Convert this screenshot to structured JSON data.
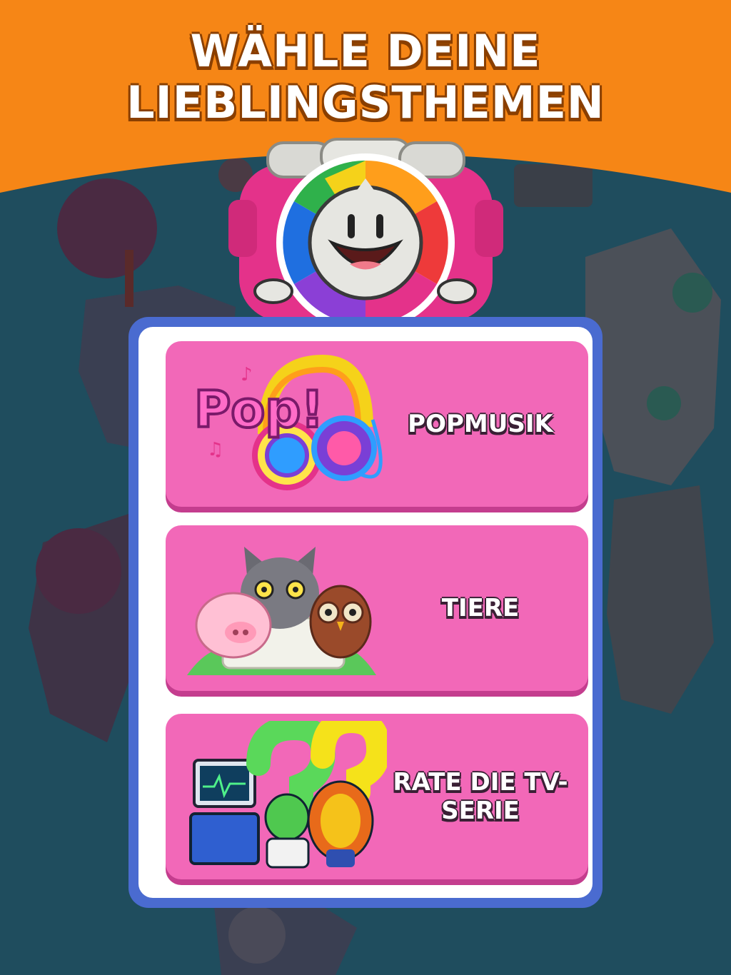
{
  "header": {
    "title_line1": "WÄHLE DEINE",
    "title_line2": "LIEBLINGSTHEMEN",
    "background_color": "#f68616"
  },
  "mascot": {
    "icon": "trivia-wheel-mascot-icon"
  },
  "topics": [
    {
      "label": "POPMUSIK",
      "icon": "pop-music-headphones-icon"
    },
    {
      "label": "TIERE",
      "icon": "animals-pig-cat-owl-icon"
    },
    {
      "label": "RATE DIE TV-SERIE",
      "icon": "tv-series-characters-icon"
    }
  ],
  "colors": {
    "card": "#f268b8",
    "card_shadow": "#c43d8e",
    "panel_border": "#4a6bd0",
    "background": "#1f4d5e",
    "header": "#f68616"
  }
}
